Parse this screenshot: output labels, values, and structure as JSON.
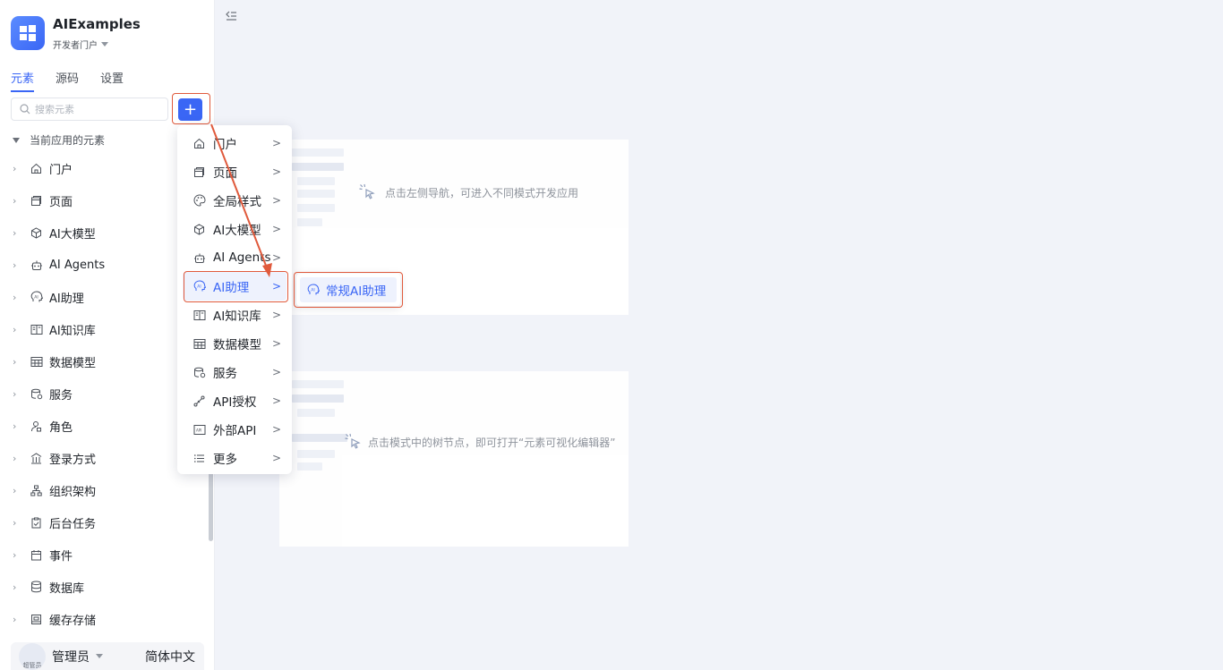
{
  "app": {
    "name": "AIExamples",
    "portal": "开发者门户"
  },
  "sidebar": {
    "tabs": [
      {
        "label": "元素"
      },
      {
        "label": "源码"
      },
      {
        "label": "设置"
      }
    ],
    "search_placeholder": "搜索元素",
    "add_label": "+",
    "tree_header": "当前应用的元素",
    "items": [
      {
        "label": "门户",
        "icon": "home-icon"
      },
      {
        "label": "页面",
        "icon": "page-icon"
      },
      {
        "label": "AI大模型",
        "icon": "cube-icon"
      },
      {
        "label": "AI Agents",
        "icon": "robot-icon"
      },
      {
        "label": "AI助理",
        "icon": "ai-assistant-icon"
      },
      {
        "label": "AI知识库",
        "icon": "book-icon"
      },
      {
        "label": "数据模型",
        "icon": "table-icon"
      },
      {
        "label": "服务",
        "icon": "database-service-icon"
      },
      {
        "label": "角色",
        "icon": "user-role-icon"
      },
      {
        "label": "登录方式",
        "icon": "bank-icon"
      },
      {
        "label": "组织架构",
        "icon": "org-chart-icon"
      },
      {
        "label": "后台任务",
        "icon": "task-icon"
      },
      {
        "label": "事件",
        "icon": "calendar-icon"
      },
      {
        "label": "数据库",
        "icon": "database-icon"
      },
      {
        "label": "缓存存储",
        "icon": "storage-icon"
      }
    ]
  },
  "user": {
    "name": "管理员",
    "avatar_text": "超管员",
    "language": "简体中文"
  },
  "main": {
    "hint1": "点击左侧导航，可进入不同模式开发应用",
    "hint2": "点击模式中的树节点，即可打开“元素可视化编辑器”"
  },
  "menu": {
    "items": [
      {
        "label": "门户",
        "icon": "home-icon"
      },
      {
        "label": "页面",
        "icon": "page-icon"
      },
      {
        "label": "全局样式",
        "icon": "palette-icon"
      },
      {
        "label": "AI大模型",
        "icon": "cube-icon"
      },
      {
        "label": "AI Agents",
        "icon": "robot-icon"
      },
      {
        "label": "AI助理",
        "icon": "ai-assistant-icon",
        "active": true
      },
      {
        "label": "AI知识库",
        "icon": "book-icon"
      },
      {
        "label": "数据模型",
        "icon": "table-icon"
      },
      {
        "label": "服务",
        "icon": "database-service-icon"
      },
      {
        "label": "API授权",
        "icon": "link-icon"
      },
      {
        "label": "外部API",
        "icon": "api-icon"
      },
      {
        "label": "更多",
        "icon": "list-icon"
      }
    ],
    "arrow": ">"
  },
  "submenu": {
    "label": "常规AI助理",
    "icon": "ai-assistant-icon"
  },
  "colors": {
    "accent": "#3a66f5",
    "highlight": "#e05a3c"
  }
}
